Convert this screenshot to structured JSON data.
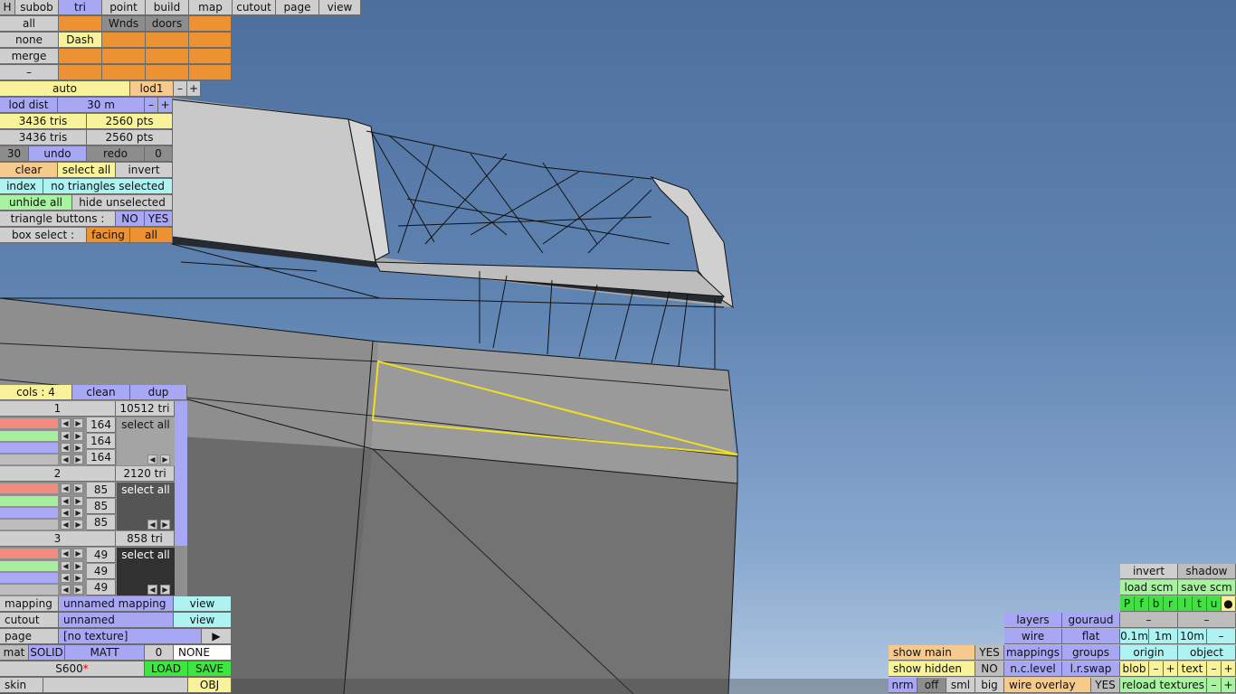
{
  "top_menu": [
    "H",
    "subob",
    "tri",
    "point",
    "build",
    "map",
    "cutout",
    "page",
    "view"
  ],
  "grid": {
    "row1": [
      "all",
      "",
      "Wnds",
      "doors",
      ""
    ],
    "row2": [
      "none",
      "Dash",
      "",
      "",
      ""
    ],
    "row3": [
      "merge",
      "",
      "",
      "",
      ""
    ],
    "row4": [
      "–",
      "",
      "",
      "",
      ""
    ]
  },
  "lod": {
    "auto": "auto",
    "lod1": "lod1",
    "minus": "–",
    "plus": "+",
    "lod_dist": "lod dist",
    "dist_val": "30 m"
  },
  "stats": {
    "tris1": "3436 tris",
    "pts1": "2560 pts",
    "tris2": "3436 tris",
    "pts2": "2560 pts"
  },
  "undo_row": {
    "count": "30",
    "undo": "undo",
    "redo": "redo",
    "redo_count": "0"
  },
  "sel_row": {
    "clear": "clear",
    "select_all": "select all",
    "invert": "invert"
  },
  "index_row": {
    "index": "index",
    "status": "no triangles selected"
  },
  "hide_row": {
    "unhide": "unhide all",
    "hide": "hide unselected"
  },
  "tri_buttons": {
    "label": "triangle buttons :",
    "no": "NO",
    "yes": "YES"
  },
  "box_select": {
    "label": "box select :",
    "facing": "facing",
    "all": "all"
  },
  "cols": {
    "label": "cols : 4",
    "clean": "clean",
    "dup": "dup"
  },
  "colors": [
    {
      "idx": "1",
      "tri": "10512 tri",
      "vals": [
        "164",
        "164",
        "164"
      ],
      "select": "select all"
    },
    {
      "idx": "2",
      "tri": "2120 tri",
      "vals": [
        "85",
        "85",
        "85"
      ],
      "select": "select all"
    },
    {
      "idx": "3",
      "tri": "858 tri",
      "vals": [
        "49",
        "49",
        "49"
      ],
      "select": "select all"
    }
  ],
  "mapping": {
    "label": "mapping",
    "value": "unnamed mapping",
    "view": "view"
  },
  "cutout": {
    "label": "cutout",
    "value": "unnamed",
    "view": "view"
  },
  "page": {
    "label": "page",
    "value": "[no texture]",
    "arrow": "▶"
  },
  "mat": {
    "label": "mat",
    "solid": "SOLID",
    "matt": "MATT",
    "num": "0",
    "none": "NONE"
  },
  "file": {
    "name": "S600",
    "star": "*",
    "load": "LOAD",
    "save": "SAVE"
  },
  "skin": {
    "label": "skin",
    "obj": "OBJ"
  },
  "right": {
    "invert": "invert",
    "shadow": "shadow",
    "load_scm": "load scm",
    "save_scm": "save scm",
    "letters": [
      "P",
      "f",
      "b",
      "r",
      "l",
      "t",
      "u",
      "●"
    ],
    "layers": "layers",
    "gouraud": "gouraud",
    "dash1": "–",
    "dash2": "–",
    "wire": "wire",
    "flat": "flat",
    "d01": "0.1m",
    "d1": "1m",
    "d10": "10m",
    "dminus": "–",
    "show_main": "show main",
    "show_main_val": "YES",
    "mappings": "mappings",
    "groups": "groups",
    "origin": "origin",
    "object": "object",
    "show_hidden": "show hidden",
    "show_hidden_val": "NO",
    "nclevel": "n.c.level",
    "lrswap": "l.r.swap",
    "blob": "blob",
    "blob_m": "–",
    "blob_p": "+",
    "text": "text",
    "text_m": "–",
    "text_p": "+",
    "nrm": "nrm",
    "off": "off",
    "sml": "sml",
    "big": "big",
    "wire_overlay": "wire overlay",
    "wire_overlay_val": "YES",
    "reload": "reload textures",
    "rel_m": "–",
    "rel_p": "+"
  }
}
